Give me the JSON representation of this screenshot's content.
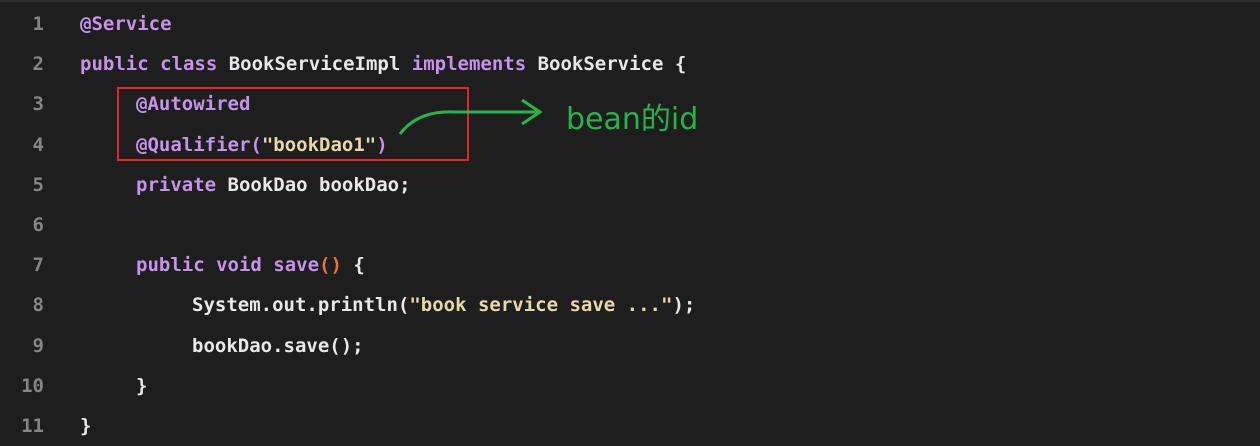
{
  "lines": [
    {
      "n": "1",
      "parts": [
        {
          "t": "@Service",
          "c": "ann"
        }
      ]
    },
    {
      "n": "2",
      "parts": [
        {
          "t": "public class ",
          "c": "kw"
        },
        {
          "t": "BookServiceImpl",
          "c": "txt"
        },
        {
          "t": " implements ",
          "c": "kw"
        },
        {
          "t": "BookService",
          "c": "txt"
        },
        {
          "t": " {",
          "c": "txt"
        }
      ]
    },
    {
      "n": "3",
      "parts": [
        {
          "t": "@Autowired",
          "c": "ann"
        }
      ]
    },
    {
      "n": "4",
      "parts": [
        {
          "t": "@Qualifier(",
          "c": "ann"
        },
        {
          "t": "\"bookDao1\"",
          "c": "str"
        },
        {
          "t": ")",
          "c": "ann"
        }
      ]
    },
    {
      "n": "5",
      "parts": [
        {
          "t": "private ",
          "c": "kw"
        },
        {
          "t": "BookDao bookDao;",
          "c": "txt"
        }
      ]
    },
    {
      "n": "6",
      "parts": []
    },
    {
      "n": "7",
      "parts": [
        {
          "t": "public void ",
          "c": "kw"
        },
        {
          "t": "save",
          "c": "fn"
        },
        {
          "t": "()",
          "c": "paren"
        },
        {
          "t": " {",
          "c": "txt"
        }
      ]
    },
    {
      "n": "8",
      "parts": [
        {
          "t": "System.out.println(",
          "c": "txt"
        },
        {
          "t": "\"book service save ...\"",
          "c": "str"
        },
        {
          "t": ");",
          "c": "txt"
        }
      ]
    },
    {
      "n": "9",
      "parts": [
        {
          "t": "bookDao.save();",
          "c": "txt"
        }
      ]
    },
    {
      "n": "10",
      "parts": [
        {
          "t": "}",
          "c": "txt"
        }
      ]
    },
    {
      "n": "11",
      "parts": [
        {
          "t": "}",
          "c": "txt"
        }
      ]
    }
  ],
  "annotation": {
    "text": "bean的id"
  },
  "colors": {
    "background": "#1e1e1e",
    "highlight_box": "#e0262a",
    "annotation": "#29b34a"
  }
}
